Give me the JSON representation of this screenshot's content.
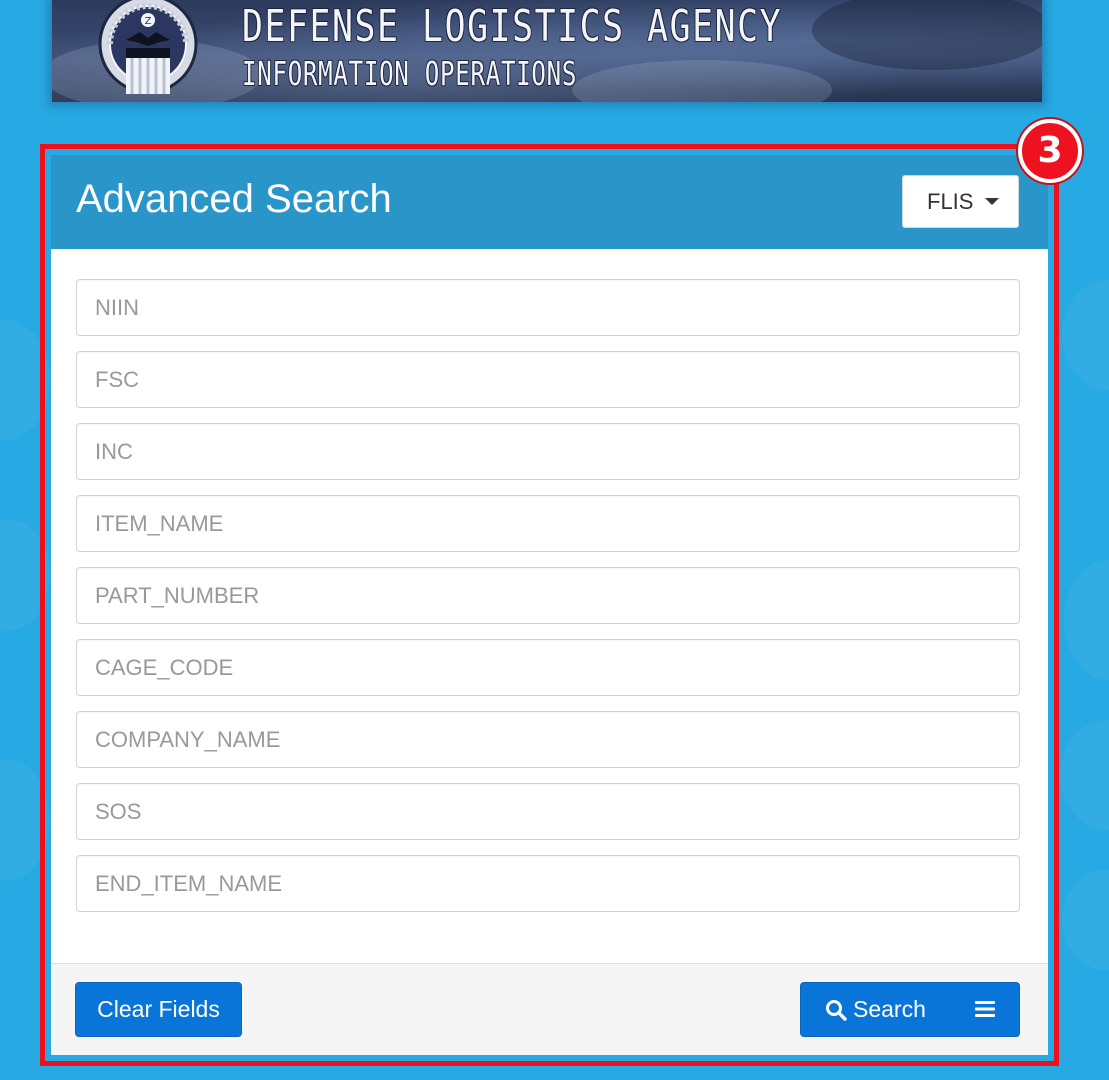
{
  "banner": {
    "title": "DEFENSE LOGISTICS AGENCY",
    "subtitle": "INFORMATION OPERATIONS",
    "logo_icon": "dla-seal-icon"
  },
  "annotation": {
    "step_number": "3",
    "color": "#ef0f1a"
  },
  "panel": {
    "title": "Advanced Search",
    "dropdown": {
      "selected": "FLIS",
      "icon": "caret-down-icon"
    },
    "fields": [
      {
        "placeholder": "NIIN",
        "value": ""
      },
      {
        "placeholder": "FSC",
        "value": ""
      },
      {
        "placeholder": "INC",
        "value": ""
      },
      {
        "placeholder": "ITEM_NAME",
        "value": ""
      },
      {
        "placeholder": "PART_NUMBER",
        "value": ""
      },
      {
        "placeholder": "CAGE_CODE",
        "value": ""
      },
      {
        "placeholder": "COMPANY_NAME",
        "value": ""
      },
      {
        "placeholder": "SOS",
        "value": ""
      },
      {
        "placeholder": "END_ITEM_NAME",
        "value": ""
      }
    ],
    "footer": {
      "clear_label": "Clear Fields",
      "search_label": "Search",
      "search_icon": "search-icon",
      "menu_icon": "hamburger-menu-icon"
    }
  },
  "colors": {
    "page_background": "#27a9e3",
    "panel_header": "#2a95c9",
    "primary_button": "#0a75d9",
    "footer_background": "#f5f5f5"
  }
}
